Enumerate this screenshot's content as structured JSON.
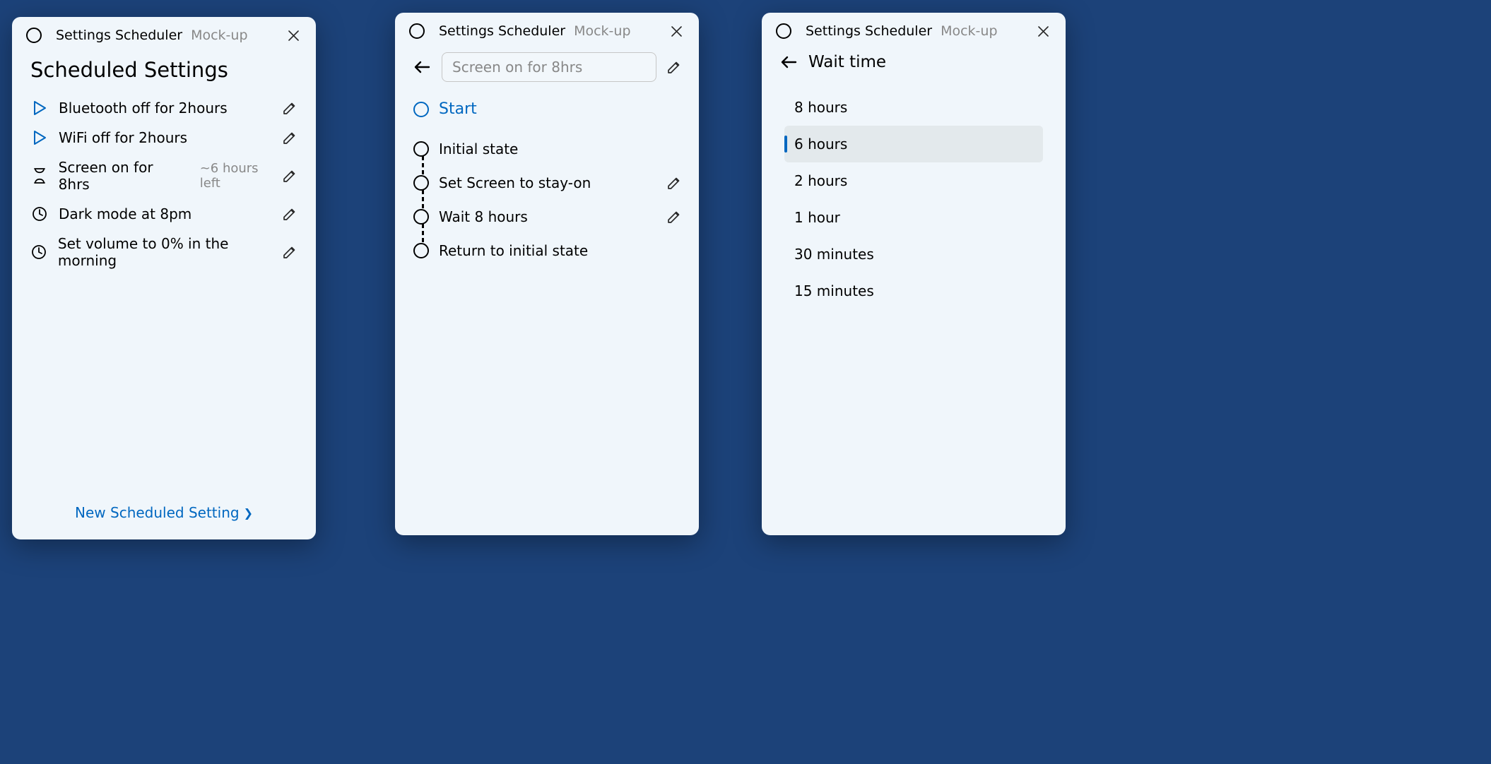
{
  "app": {
    "title": "Settings Scheduler",
    "subtitle": "Mock-up"
  },
  "panel1": {
    "heading": "Scheduled Settings",
    "items": [
      {
        "icon": "play",
        "label": "Bluetooth off for 2hours",
        "meta": ""
      },
      {
        "icon": "play",
        "label": "WiFi off for 2hours",
        "meta": ""
      },
      {
        "icon": "hourglass",
        "label": "Screen on for 8hrs",
        "meta": "~6 hours left"
      },
      {
        "icon": "clock",
        "label": "Dark mode at  8pm",
        "meta": ""
      },
      {
        "icon": "clock",
        "label": "Set volume to 0% in the morning",
        "meta": ""
      }
    ],
    "new_link": "New Scheduled Setting"
  },
  "panel2": {
    "name_value": "Screen on for 8hrs",
    "start_label": "Start",
    "steps": [
      {
        "label": "Initial state",
        "editable": false
      },
      {
        "label": "Set Screen to stay-on",
        "editable": true
      },
      {
        "label": "Wait 8 hours",
        "editable": true
      },
      {
        "label": "Return to initial state",
        "editable": false
      }
    ]
  },
  "panel3": {
    "heading": "Wait time",
    "options": [
      {
        "label": "8 hours",
        "selected": false
      },
      {
        "label": "6 hours",
        "selected": true
      },
      {
        "label": "2 hours",
        "selected": false
      },
      {
        "label": "1 hour",
        "selected": false
      },
      {
        "label": "30 minutes",
        "selected": false
      },
      {
        "label": "15 minutes",
        "selected": false
      }
    ]
  }
}
